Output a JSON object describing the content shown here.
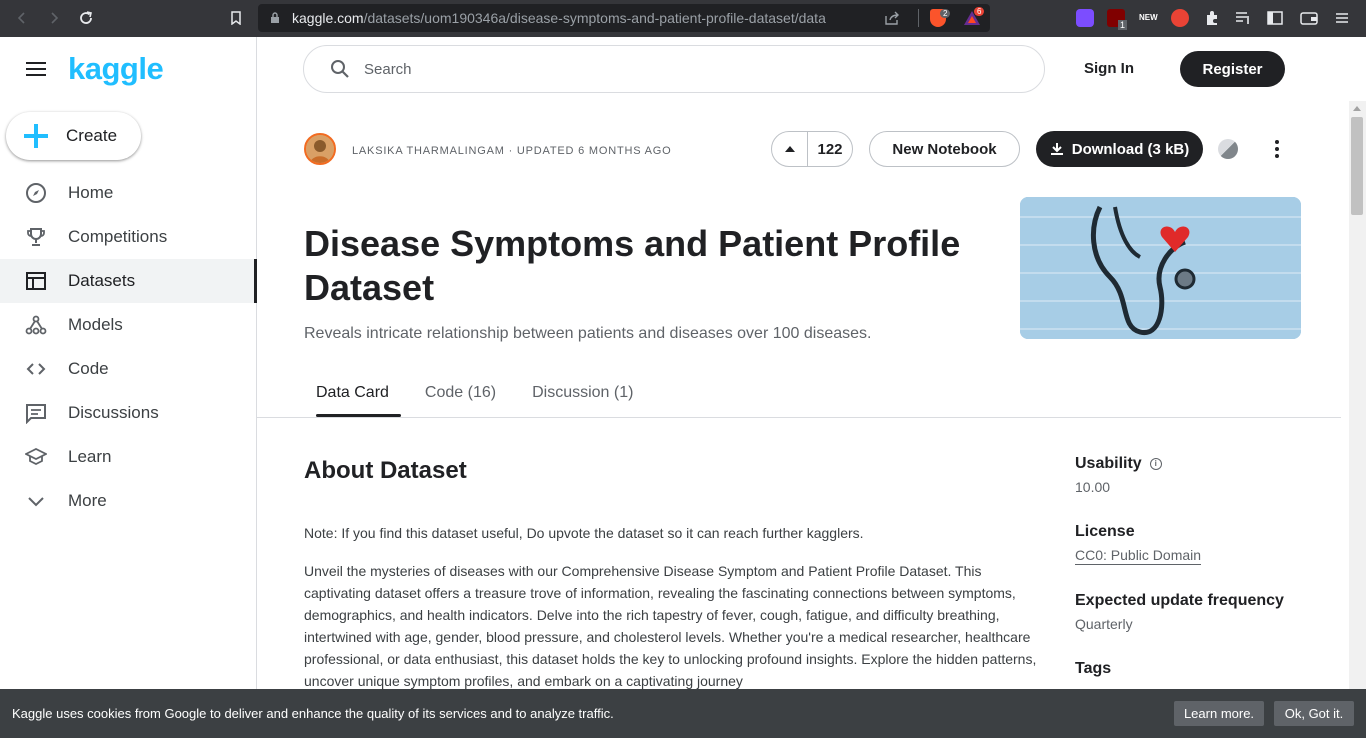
{
  "browser": {
    "url_domain": "kaggle.com",
    "url_path": "/datasets/uom190346a/disease-symptoms-and-patient-profile-dataset/data",
    "extension_badges": [
      "2",
      "6",
      "1"
    ],
    "extension_new_label": "NEW"
  },
  "sidebar": {
    "logo": "kaggle",
    "create_label": "Create",
    "items": [
      {
        "label": "Home",
        "icon": "compass-icon"
      },
      {
        "label": "Competitions",
        "icon": "trophy-icon"
      },
      {
        "label": "Datasets",
        "icon": "table-icon"
      },
      {
        "label": "Models",
        "icon": "models-icon"
      },
      {
        "label": "Code",
        "icon": "code-icon"
      },
      {
        "label": "Discussions",
        "icon": "discussion-icon"
      },
      {
        "label": "Learn",
        "icon": "school-icon"
      },
      {
        "label": "More",
        "icon": "chevron-down-icon"
      }
    ],
    "active_item": "Datasets"
  },
  "header": {
    "search_placeholder": "Search",
    "signin_label": "Sign In",
    "register_label": "Register"
  },
  "dataset": {
    "byline": "LAKSIKA THARMALINGAM · UPDATED 6 MONTHS AGO",
    "votes": "122",
    "new_notebook_label": "New Notebook",
    "download_label": "Download (3 kB)",
    "title": "Disease Symptoms and Patient Profile Dataset",
    "subtitle": "Reveals intricate relationship between patients and diseases over 100 diseases.",
    "tabs": [
      {
        "label": "Data Card",
        "active": true
      },
      {
        "label": "Code (16)",
        "active": false
      },
      {
        "label": "Discussion (1)",
        "active": false
      }
    ]
  },
  "content": {
    "heading": "About Dataset",
    "paragraph1": "Note: If you find this dataset useful, Do upvote the dataset so it can reach further kagglers.",
    "paragraph2": "Unveil the mysteries of diseases with our Comprehensive Disease Symptom and Patient Profile Dataset. This captivating dataset offers a treasure trove of information, revealing the fascinating connections between symptoms, demographics, and health indicators. Delve into the rich tapestry of fever, cough, fatigue, and difficulty breathing, intertwined with age, gender, blood pressure, and cholesterol levels. Whether you're a medical researcher, healthcare professional, or data enthusiast, this dataset holds the key to unlocking profound insights. Explore the hidden patterns, uncover unique symptom profiles, and embark on a captivating journey"
  },
  "metadata": {
    "usability_label": "Usability",
    "usability_value": "10.00",
    "license_label": "License",
    "license_value": "CC0: Public Domain",
    "frequency_label": "Expected update frequency",
    "frequency_value": "Quarterly",
    "tags_label": "Tags"
  },
  "cookie": {
    "text": "Kaggle uses cookies from Google to deliver and enhance the quality of its services and to analyze traffic.",
    "learn_more": "Learn more.",
    "ok": "Ok, Got it."
  },
  "colors": {
    "kaggle_blue": "#20beff",
    "dark": "#202124",
    "chrome_bg": "#35363a"
  }
}
